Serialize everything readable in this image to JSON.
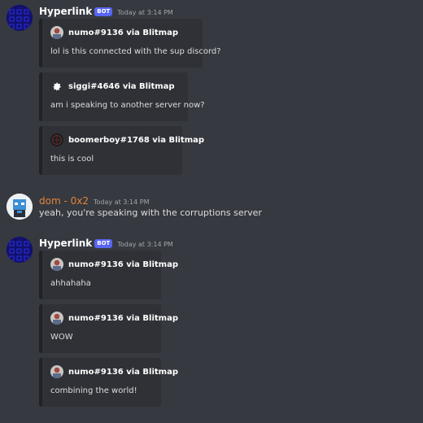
{
  "messages": [
    {
      "username": "Hyperlink",
      "badge": "BOT",
      "timestamp": "Today at 3:14 PM",
      "embeds": [
        {
          "author": "numo#9136 via Blitmap",
          "text": "lol is this connected with the sup discord?",
          "icon": "numo-avatar-icon"
        },
        {
          "author": "siggi#4646 via Blitmap",
          "text": "am i speaking to another server now?",
          "icon": "siggi-avatar-icon"
        },
        {
          "author": "boomerboy#1768 via Blitmap",
          "text": "this is cool",
          "icon": "boomerboy-avatar-icon"
        }
      ]
    },
    {
      "username": "dom - 0x2",
      "timestamp": "Today at 3:14 PM",
      "text": "yeah, you're speaking with the corruptions server"
    },
    {
      "username": "Hyperlink",
      "badge": "BOT",
      "timestamp": "Today at 3:14 PM",
      "embeds": [
        {
          "author": "numo#9136 via Blitmap",
          "text": "ahhahaha",
          "icon": "numo-avatar-icon"
        },
        {
          "author": "numo#9136 via Blitmap",
          "text": "WOW",
          "icon": "numo-avatar-icon"
        },
        {
          "author": "numo#9136 via Blitmap",
          "text": "combining the world!",
          "icon": "numo-avatar-icon"
        }
      ]
    }
  ],
  "colors": {
    "background": "#36393f",
    "embed_bg": "#2f3136",
    "bot_badge": "#5865f2",
    "dom_name": "#e3853b"
  }
}
